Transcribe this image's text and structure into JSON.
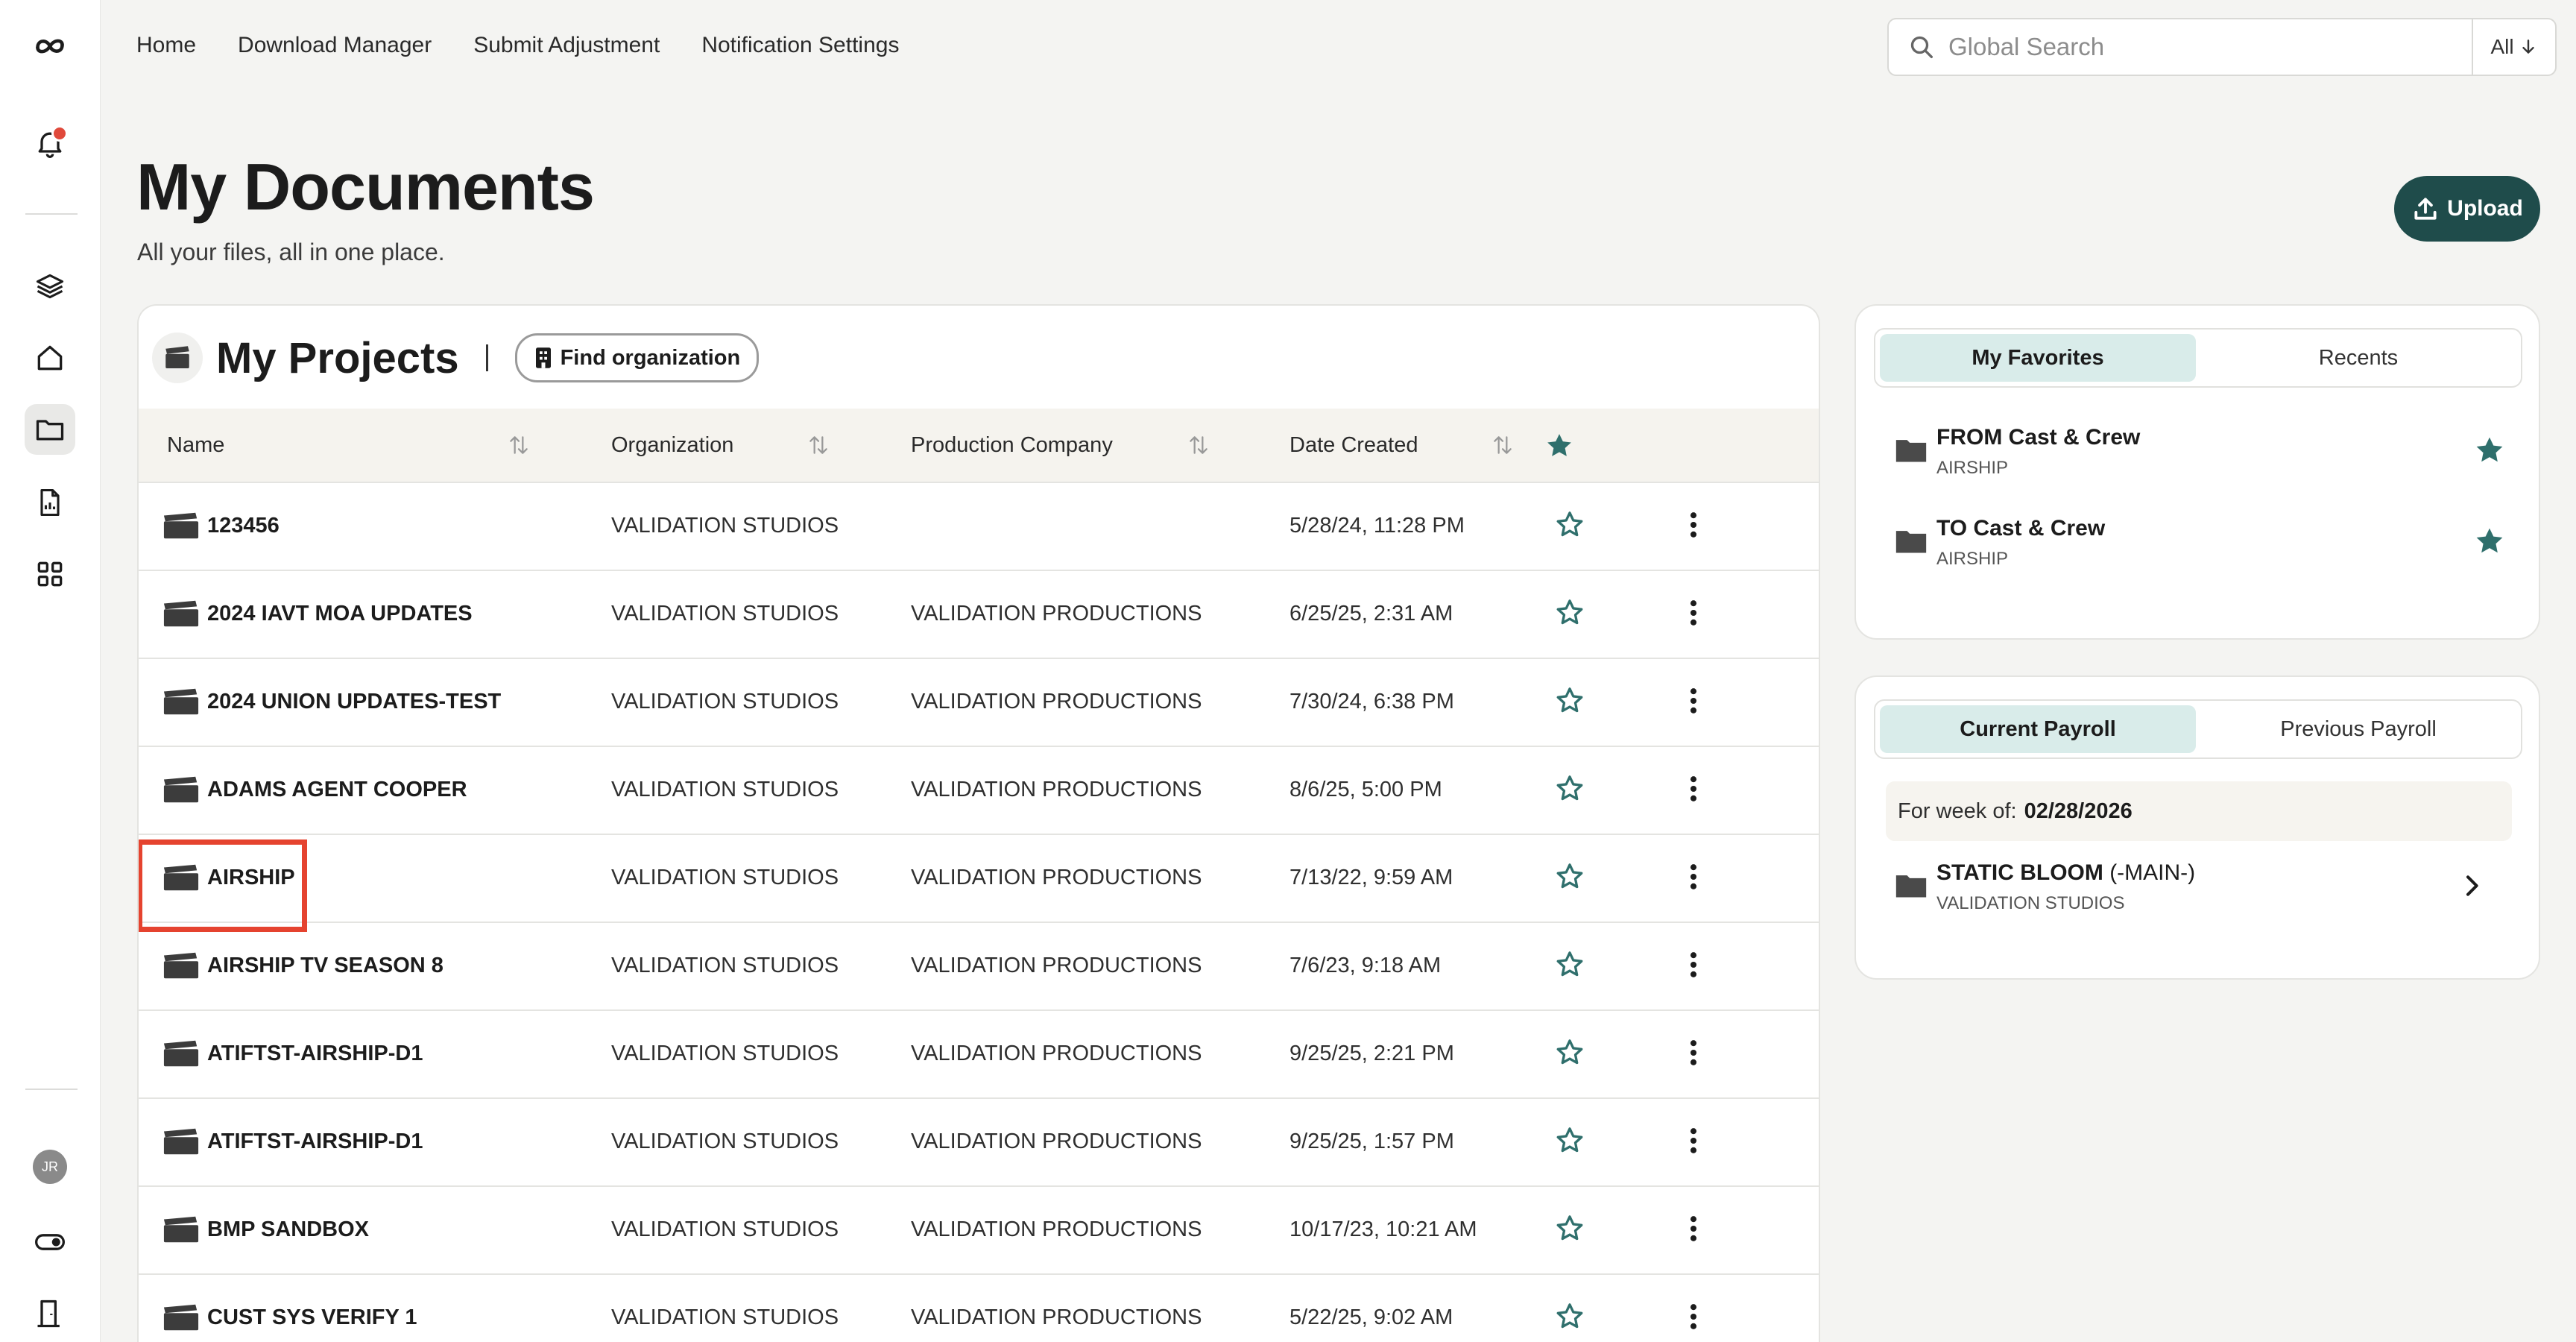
{
  "nav": {
    "items": [
      "Home",
      "Download Manager",
      "Submit Adjustment",
      "Notification Settings"
    ]
  },
  "search": {
    "placeholder": "Global Search",
    "scope": "All"
  },
  "header": {
    "title": "My Documents",
    "subtitle": "All your files, all in one place.",
    "upload_label": "Upload"
  },
  "sidebar": {
    "avatar_initials": "JR"
  },
  "projects": {
    "title": "My Projects",
    "find_org_label": "Find organization",
    "columns": {
      "name": "Name",
      "organization": "Organization",
      "production_company": "Production Company",
      "date_created": "Date Created"
    },
    "rows": [
      {
        "name": "123456",
        "organization": "VALIDATION STUDIOS",
        "production_company": "",
        "date_created": "5/28/24, 11:28 PM"
      },
      {
        "name": "2024 IAVT MOA UPDATES",
        "organization": "VALIDATION STUDIOS",
        "production_company": "VALIDATION PRODUCTIONS",
        "date_created": "6/25/25, 2:31 AM"
      },
      {
        "name": "2024 UNION UPDATES-TEST",
        "organization": "VALIDATION STUDIOS",
        "production_company": "VALIDATION PRODUCTIONS",
        "date_created": "7/30/24, 6:38 PM"
      },
      {
        "name": "ADAMS AGENT COOPER",
        "organization": "VALIDATION STUDIOS",
        "production_company": "VALIDATION PRODUCTIONS",
        "date_created": "8/6/25, 5:00 PM"
      },
      {
        "name": "AIRSHIP",
        "organization": "VALIDATION STUDIOS",
        "production_company": "VALIDATION PRODUCTIONS",
        "date_created": "7/13/22, 9:59 AM"
      },
      {
        "name": "AIRSHIP TV SEASON 8",
        "organization": "VALIDATION STUDIOS",
        "production_company": "VALIDATION PRODUCTIONS",
        "date_created": "7/6/23, 9:18 AM"
      },
      {
        "name": "ATIFTST-AIRSHIP-D1",
        "organization": "VALIDATION STUDIOS",
        "production_company": "VALIDATION PRODUCTIONS",
        "date_created": "9/25/25, 2:21 PM"
      },
      {
        "name": "ATIFTST-AIRSHIP-D1",
        "organization": "VALIDATION STUDIOS",
        "production_company": "VALIDATION PRODUCTIONS",
        "date_created": "9/25/25, 1:57 PM"
      },
      {
        "name": "BMP SANDBOX",
        "organization": "VALIDATION STUDIOS",
        "production_company": "VALIDATION PRODUCTIONS",
        "date_created": "10/17/23, 10:21 AM"
      },
      {
        "name": "CUST SYS VERIFY 1",
        "organization": "VALIDATION STUDIOS",
        "production_company": "VALIDATION PRODUCTIONS",
        "date_created": "5/22/25, 9:02 AM"
      }
    ]
  },
  "favorites": {
    "tabs": [
      "My Favorites",
      "Recents"
    ],
    "items": [
      {
        "title": "FROM Cast & Crew",
        "subtitle": "AIRSHIP"
      },
      {
        "title": "TO Cast & Crew",
        "subtitle": "AIRSHIP"
      }
    ]
  },
  "payroll": {
    "tabs": [
      "Current Payroll",
      "Previous Payroll"
    ],
    "week_label": "For week of:",
    "week_value": "02/28/2026",
    "item": {
      "title": "STATIC BLOOM",
      "title_suffix": " (-MAIN-)",
      "subtitle": "VALIDATION STUDIOS"
    }
  },
  "colors": {
    "accent": "#1f4c4b",
    "tab_active": "#d9ecea",
    "star_filled": "#2f6f6c",
    "highlight": "#e5432f"
  }
}
